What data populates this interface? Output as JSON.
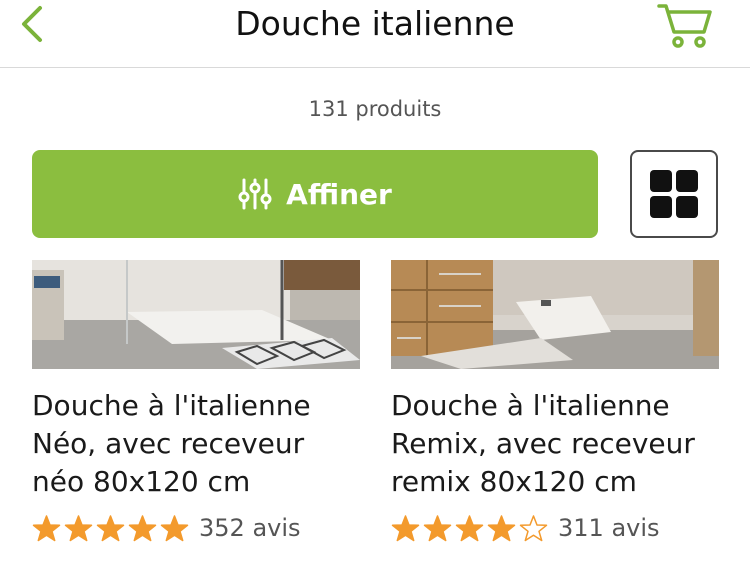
{
  "header": {
    "title": "Douche italienne",
    "back_icon": "chevron-left-icon",
    "cart_icon": "cart-icon"
  },
  "listing": {
    "count_label": "131 produits"
  },
  "filters": {
    "refine_label": "Affiner",
    "refine_icon": "sliders-icon",
    "view_toggle_icon": "grid-view-icon"
  },
  "colors": {
    "accent_green": "#8bbe3f",
    "star_orange": "#f39a2c"
  },
  "products": [
    {
      "title": "Douche à l'italienne Néo, avec receveur néo 80x120 cm",
      "rating": 5,
      "max_rating": 5,
      "reviews_label": "352 avis"
    },
    {
      "title": "Douche à l'italienne Remix, avec receveur remix 80x120 cm",
      "rating": 4,
      "max_rating": 5,
      "reviews_label": "311 avis"
    }
  ]
}
